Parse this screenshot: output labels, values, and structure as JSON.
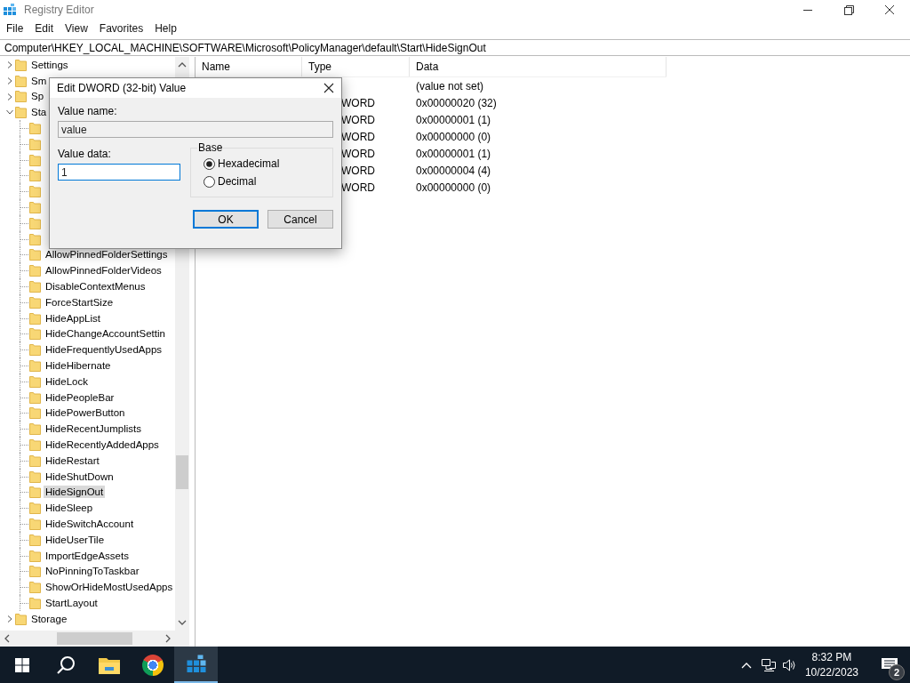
{
  "window": {
    "title": "Registry Editor"
  },
  "menu": [
    "File",
    "Edit",
    "View",
    "Favorites",
    "Help"
  ],
  "address": "Computer\\HKEY_LOCAL_MACHINE\\SOFTWARE\\Microsoft\\PolicyManager\\default\\Start\\HideSignOut",
  "tree": [
    {
      "label": "Settings",
      "expanded": false,
      "selected": false
    },
    {
      "label": "Sm",
      "expanded": false,
      "selected": false
    },
    {
      "label": "Sp",
      "expanded": false,
      "selected": false
    },
    {
      "label": "Sta",
      "expanded": true,
      "selected": false,
      "children": [
        {
          "selected": false
        },
        {
          "selected": false
        },
        {
          "selected": false
        },
        {
          "selected": false
        },
        {
          "selected": false
        },
        {
          "selected": false
        },
        {
          "selected": false
        },
        {
          "selected": false
        },
        {
          "label": "AllowPinnedFolderSettings",
          "selected": false
        },
        {
          "label": "AllowPinnedFolderVideos",
          "selected": false
        },
        {
          "label": "DisableContextMenus",
          "selected": false
        },
        {
          "label": "ForceStartSize",
          "selected": false
        },
        {
          "label": "HideAppList",
          "selected": false
        },
        {
          "label": "HideChangeAccountSettin",
          "selected": false
        },
        {
          "label": "HideFrequentlyUsedApps",
          "selected": false
        },
        {
          "label": "HideHibernate",
          "selected": false
        },
        {
          "label": "HideLock",
          "selected": false
        },
        {
          "label": "HidePeopleBar",
          "selected": false
        },
        {
          "label": "HidePowerButton",
          "selected": false
        },
        {
          "label": "HideRecentJumplists",
          "selected": false
        },
        {
          "label": "HideRecentlyAddedApps",
          "selected": false
        },
        {
          "label": "HideRestart",
          "selected": false
        },
        {
          "label": "HideShutDown",
          "selected": false
        },
        {
          "label": "HideSignOut",
          "selected": true
        },
        {
          "label": "HideSleep",
          "selected": false
        },
        {
          "label": "HideSwitchAccount",
          "selected": false
        },
        {
          "label": "HideUserTile",
          "selected": false
        },
        {
          "label": "ImportEdgeAssets",
          "selected": false
        },
        {
          "label": "NoPinningToTaskbar",
          "selected": false
        },
        {
          "label": "ShowOrHideMostUsedApps",
          "selected": false
        },
        {
          "label": "StartLayout",
          "selected": false
        }
      ]
    },
    {
      "label": "Storage",
      "expanded": false,
      "selected": false
    }
  ],
  "list": {
    "columns": [
      "Name",
      "Type",
      "Data"
    ],
    "rows": [
      {
        "data": "(value not set)"
      },
      {
        "type": "WORD",
        "data": "0x00000020 (32)"
      },
      {
        "type": "WORD",
        "data": "0x00000001 (1)"
      },
      {
        "type": "WORD",
        "data": "0x00000000 (0)"
      },
      {
        "type": "WORD",
        "data": "0x00000001 (1)"
      },
      {
        "type": "WORD",
        "data": "0x00000004 (4)"
      },
      {
        "type": "WORD",
        "data": "0x00000000 (0)"
      }
    ]
  },
  "dialog": {
    "title": "Edit DWORD (32-bit) Value",
    "value_name_label": "Value name:",
    "value_name": "value",
    "value_data_label": "Value data:",
    "value_data": "1",
    "base": {
      "label": "Base",
      "options": [
        {
          "label": "Hexadecimal",
          "selected": true
        },
        {
          "label": "Decimal",
          "selected": false
        }
      ]
    },
    "buttons": [
      {
        "label": "OK",
        "default": true
      },
      {
        "label": "Cancel",
        "default": false
      }
    ]
  },
  "taskbar": {
    "apps": [
      {
        "kind": "start",
        "active": false
      },
      {
        "kind": "search",
        "active": false
      },
      {
        "kind": "explorer",
        "active": false
      },
      {
        "kind": "chrome",
        "active": false
      },
      {
        "kind": "regedit",
        "active": true
      }
    ],
    "time": "8:32 PM",
    "date": "10/22/2023",
    "notifications": "2"
  }
}
